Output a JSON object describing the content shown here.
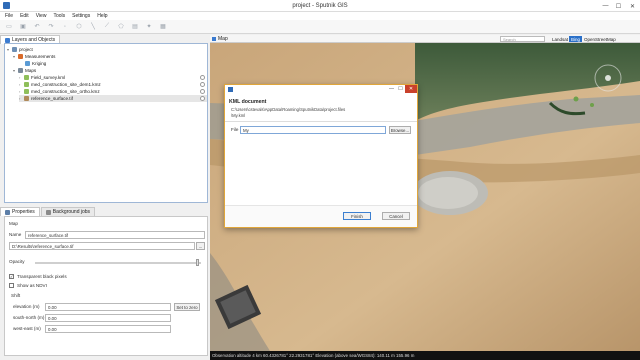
{
  "window": {
    "title": "project - Sputnik GIS",
    "minimize": "—",
    "maximize": "☐",
    "close": "✕"
  },
  "menu": [
    "File",
    "Edit",
    "View",
    "Tools",
    "Settings",
    "Help"
  ],
  "toolbar": [
    "open-icon",
    "save-icon",
    "undo-icon",
    "redo-icon",
    "point-icon",
    "polygon-icon",
    "line-icon",
    "ruler-icon",
    "shape-icon",
    "layers-icon",
    "satellite-icon",
    "table-icon"
  ],
  "layers_panel": {
    "tab_label": "Layers and Objects",
    "items": [
      {
        "label": "project",
        "level": 0,
        "expand": "▾"
      },
      {
        "label": "Measurements",
        "level": 1,
        "expand": "▾"
      },
      {
        "label": "Kriging",
        "level": 2,
        "expand": ""
      },
      {
        "label": "Maps",
        "level": 1,
        "expand": "▾"
      },
      {
        "label": "Field_survey.kml",
        "level": 2,
        "expand": "›"
      },
      {
        "label": "med_construction_site_dem1.kmz",
        "level": 2,
        "expand": "›"
      },
      {
        "label": "med_construction_site_ortho.kmz",
        "level": 2,
        "expand": "›"
      },
      {
        "label": "reference_surface.tif",
        "level": 2,
        "expand": "›"
      }
    ]
  },
  "properties_panel": {
    "tabs": [
      "Properties",
      "Background jobs"
    ],
    "section": "Map",
    "name_label": "Name",
    "name_value": "reference_surface.tif",
    "path_value": "D:\\Results\\reference_surface.tif",
    "browse_small": "...",
    "opacity_label": "Opacity",
    "opacity_level": 0.98,
    "transparent_label": "Transparent black pixels",
    "transparent_checked": true,
    "ndvi_label": "Show as NDVI",
    "ndvi_checked": false,
    "shift_label": "Shift",
    "elevation_label": "elevation (m)",
    "elevation_value": "0.00",
    "set_zero_label": "Set to zero",
    "south_north_label": "south-north (m)",
    "south_north_value": "0.00",
    "west_east_label": "west-east (m)",
    "west_east_value": "0.00"
  },
  "map": {
    "tab_label": "Map",
    "search_placeholder": "Search",
    "basemaps": [
      "Landsat",
      "Bing",
      "OpenStreetMap"
    ],
    "active_basemap": "Bing",
    "status": "Observation altitude 4 km     60.4326781° 22.2931781°   Elevation (above sea/WGS84): 140.11 m   155.96 m"
  },
  "dialog": {
    "heading": "KML document",
    "path_line1": "C:\\Users\\cstevals\\AppData\\Roaming\\SputnikData\\project.files",
    "path_line2": "\\My.kml",
    "file_label": "File",
    "file_value": "My",
    "browse_label": "Browse...",
    "finish_label": "Finish",
    "cancel_label": "Cancel"
  },
  "colors": {
    "accent": "#2a70c9",
    "dialog_border": "#e0a63a",
    "close_red": "#c9412b"
  }
}
